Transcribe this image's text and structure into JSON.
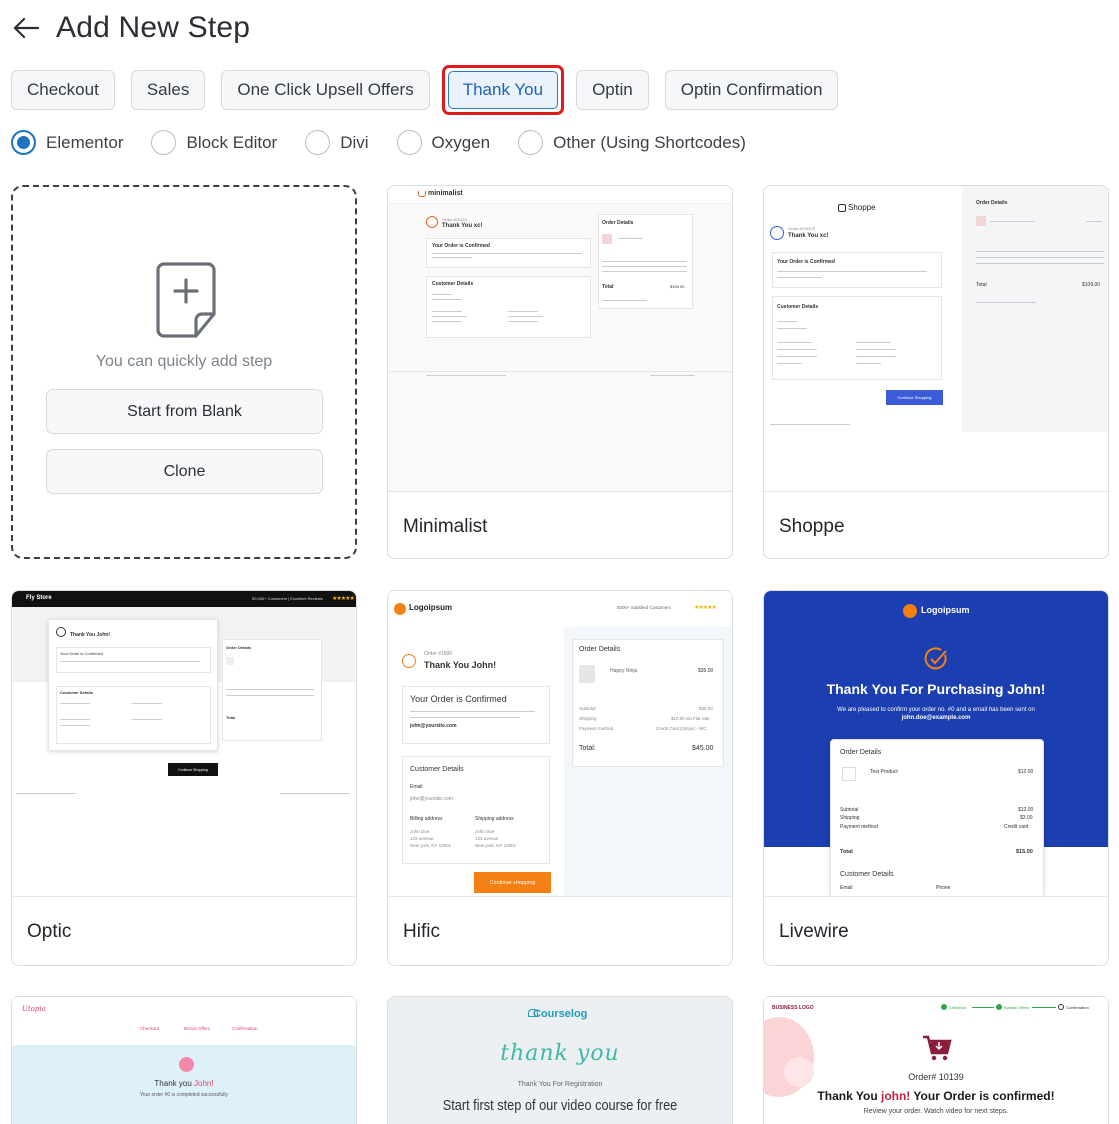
{
  "header": {
    "title": "Add New Step"
  },
  "tabs": [
    {
      "label": "Checkout",
      "active": false
    },
    {
      "label": "Sales",
      "active": false
    },
    {
      "label": "One Click Upsell Offers",
      "active": false
    },
    {
      "label": "Thank You",
      "active": true
    },
    {
      "label": "Optin",
      "active": false
    },
    {
      "label": "Optin Confirmation",
      "active": false
    }
  ],
  "builders": [
    {
      "label": "Elementor",
      "checked": true
    },
    {
      "label": "Block Editor",
      "checked": false
    },
    {
      "label": "Divi",
      "checked": false
    },
    {
      "label": "Oxygen",
      "checked": false
    },
    {
      "label": "Other (Using Shortcodes)",
      "checked": false
    }
  ],
  "blank": {
    "text": "You can quickly add step",
    "start_label": "Start from Blank",
    "clone_label": "Clone"
  },
  "templates": [
    {
      "name": "Minimalist"
    },
    {
      "name": "Shoppe"
    },
    {
      "name": "Optic"
    },
    {
      "name": "Hific"
    },
    {
      "name": "Livewire"
    }
  ],
  "previews": {
    "minimalist": {
      "brand": "minimalist",
      "order_no": "Order #00123",
      "thank": "Thank You xc!",
      "confirmed": "Your Order is Confirmed",
      "order_details": "Order Details",
      "customer_details": "Customer Details",
      "total": "Total",
      "total_value": "$109.00"
    },
    "shoppe": {
      "brand": "Shoppe",
      "order_no": "Order #123473",
      "thank": "Thank You xc!",
      "confirmed": "Your Order is Confirmed",
      "order_details": "Order Details",
      "customer_details": "Customer Details",
      "button": "Continue Shopping",
      "total": "Total",
      "total_value": "$109.00"
    },
    "optic": {
      "brand": "Fly Store",
      "header_right": "50,000+ Customers | Excellent Reviews",
      "thank": "Thank You John!",
      "confirmed": "Your Order is Confirmed",
      "customer_details": "Customer Details",
      "order_details": "Order Details",
      "total": "Total",
      "button": "Continue Shopping"
    },
    "hific": {
      "brand": "Logoipsum",
      "header_right": "5000+ Satisfied Customers",
      "order_no": "Order #1690",
      "thank": "Thank You John!",
      "confirmed": "Your Order is Confirmed",
      "email": "john@yoursite.com",
      "customer_details": "Customer Details",
      "email_label": "Email",
      "email_value": "john@yoursite.com",
      "billing": "Billing address",
      "shipping": "Shipping address",
      "addr1": "John Doe",
      "addr2": "123 avenue",
      "addr3": "New york, NY 10001",
      "order_details": "Order Details",
      "product": "Happy Ninja",
      "product_price": "$35.00",
      "subtotal_label": "Subtotal",
      "subtotal": "$35.00",
      "shipping_label": "Shipping",
      "shipping_value": "$10.00 via Flat rate",
      "payment_label": "Payment method",
      "payment_value": "Credit Card (Stripe) - WC",
      "total_label": "Total:",
      "total_value": "$45.00",
      "button": "Continue shopping"
    },
    "livewire": {
      "brand": "Logoipsum",
      "heading": "Thank You For Purchasing John!",
      "sub1": "We are pleased to confirm your order no. #0 and a email has been sent on",
      "sub2": "john.doe@example.com",
      "order_details": "Order Details",
      "product": "Test Product",
      "product_price": "$12.00",
      "subtotal_label": "Subtotal",
      "subtotal": "$12.00",
      "shipping_label": "Shipping",
      "shipping_value": "$3.00",
      "payment_label": "Payment method",
      "payment_value": "Credit card",
      "total_label": "Total",
      "total_value": "$15.00",
      "customer_details": "Customer Details",
      "email_label": "Email",
      "phone_label": "Phone"
    },
    "utopia": {
      "brand": "Utopia",
      "steps": [
        "Checkout",
        "Bonus Offers",
        "Confirmation"
      ],
      "thank_prefix": "Thank you ",
      "thank_name": "John!",
      "sub": "Your order #0 is completed successfully"
    },
    "courselog": {
      "brand": "Courselog",
      "script": "thank you",
      "sub": "Thank You For Registration",
      "headline": "Start first step of our video course for free"
    },
    "business": {
      "brand": "BUSINESS LOGO",
      "steps": [
        "Checkout",
        "Special Offers",
        "Confirmation"
      ],
      "order": "Order# 10139",
      "thank_a": "Thank You ",
      "thank_name": "john!",
      "thank_b": " Your Order is confirmed!",
      "sub": "Review your order. Watch video for next steps."
    }
  },
  "colors": {
    "accent": "#1e73be",
    "highlight": "#e01b1b",
    "hific_orange": "#f47f13",
    "livewire_blue": "#1b3fb0",
    "shoppe_button": "#3b5bd8",
    "business_red": "#8b1d3b"
  }
}
